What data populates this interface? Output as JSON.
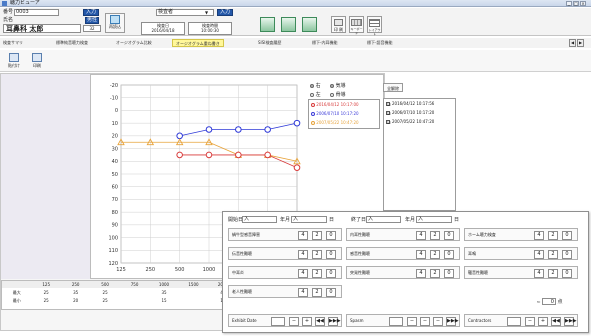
{
  "window": {
    "title": "聴力ビューア"
  },
  "toolbar": {
    "id_label": "番号",
    "id_value": "0003",
    "input_btn_1": "入力",
    "exam_select_value": "検査者",
    "input_btn_2": "入力",
    "name_kana_label": "氏名",
    "sex_btn": "男性",
    "patient_name": "耳鼻科 太郎",
    "age": "32",
    "reload_btn": "再読込",
    "exam_date_label": "検査日",
    "exam_date_value": "2016/04/18",
    "exam_time_label": "検査時間",
    "exam_time_value": "10:00:30",
    "print_btn": "印 刷",
    "keyboard_btn": "キーボード",
    "layout_btn": "レイアウト"
  },
  "tabs": [
    {
      "label": "検査サマリ"
    },
    {
      "label": "標準純音聴力検査"
    },
    {
      "label": "オージオグラム比較"
    },
    {
      "label": "オージオグラム重ね書き"
    },
    {
      "label": "SISI検査履歴"
    },
    {
      "label": "標下-内耳機能"
    },
    {
      "label": "標下-語音機能"
    }
  ],
  "tab_nav": {
    "prev": "◀",
    "next": "▶"
  },
  "subtoolbar": {
    "btn1": "貼付け",
    "btn2": "印刷"
  },
  "right_panel": {
    "ear_right": "右",
    "ear_left": "左",
    "conduction_air": "気導",
    "conduction_bone": "骨導",
    "select_all": "全解除",
    "history_list_a": [
      {
        "text": "2016/04/12 10:17:00",
        "color": "#d83a3a"
      },
      {
        "text": "2006/07/10 10:17:20",
        "color": "#3a3ad8"
      },
      {
        "text": "2007/05/22 10:47:20",
        "color": "#e6a23a"
      }
    ],
    "history_list_b": [
      {
        "text": "2016/04/12 10:17:56",
        "check": "☑"
      },
      {
        "text": "2006/07/10 10:17:20",
        "check": "☑"
      },
      {
        "text": "2007/05/22 10:47:20",
        "check": "☑"
      }
    ]
  },
  "freq_table": {
    "header": [
      "125",
      "250",
      "500",
      "750",
      "1000",
      "1500",
      "2000",
      "3000",
      "4000",
      "6000",
      "8000",
      "平均"
    ],
    "rows": [
      {
        "label": "最大",
        "values": [
          "25",
          "35",
          "25",
          "",
          "35",
          "",
          "40",
          "",
          "35",
          "",
          "50",
          "35"
        ]
      },
      {
        "label": "最小",
        "values": [
          "25",
          "20",
          "25",
          "",
          "15",
          "",
          "15",
          "",
          "15",
          "",
          "20",
          "16"
        ]
      }
    ]
  },
  "popup": {
    "start_date_label": "開始日",
    "start_date_btn": "入",
    "month_label": "年月",
    "month_btn": "入",
    "day_label": "日",
    "end_date_label": "終了日",
    "end_date_btn": "入",
    "end_month_label": "年月",
    "end_month_btn": "入",
    "end_day_label": "日",
    "grid": [
      [
        {
          "label": "蝸牛型感音障害",
          "v1": "4",
          "v2": "2",
          "v3": "0"
        },
        {
          "label": "内耳性難聴",
          "v1": "4",
          "v2": "2",
          "v3": "0"
        },
        {
          "label": "ホーム聴力検査",
          "v1": "4",
          "v2": "2",
          "v3": "0"
        }
      ],
      [
        {
          "label": "伝音性難聴",
          "v1": "4",
          "v2": "2",
          "v3": "0"
        },
        {
          "label": "感音性難聴",
          "v1": "4",
          "v2": "2",
          "v3": "0"
        },
        {
          "label": "耳鳴",
          "v1": "4",
          "v2": "2",
          "v3": "0"
        }
      ],
      [
        {
          "label": "中耳炎",
          "v1": "4",
          "v2": "2",
          "v3": "0"
        },
        {
          "label": "突発性難聴",
          "v1": "4",
          "v2": "2",
          "v3": "0"
        },
        {
          "label": "騒音性難聴",
          "v1": "4",
          "v2": "2",
          "v3": "0"
        }
      ],
      [
        {
          "label": "老人性難聴",
          "v1": "4",
          "v2": "2",
          "v3": "0"
        }
      ]
    ],
    "counter_value": "0",
    "counter_unit": "点",
    "controls": [
      {
        "label": "Exhibit Date",
        "b1": "−",
        "b2": "+",
        "b3": "◀◀",
        "b4": "▶▶▶"
      },
      {
        "label": "Spasm",
        "b1": "−",
        "b2": "−",
        "b3": "−",
        "b4": "▶▶▶"
      },
      {
        "label": "Contractors",
        "b1": "−",
        "b2": "+",
        "b3": "◀◀",
        "b4": "▶▶▶"
      }
    ]
  },
  "chart_data": {
    "type": "line",
    "x_ticks": [
      "125",
      "250",
      "500",
      "1000",
      "2000",
      "4000",
      "8000"
    ],
    "y_ticks": [
      "-20",
      "-10",
      "0",
      "10",
      "20",
      "30",
      "40",
      "50",
      "60",
      "70",
      "80",
      "90",
      "100",
      "110",
      "120"
    ],
    "ylim": [
      -20,
      120
    ],
    "y_inverted": true,
    "grid": true,
    "series": [
      {
        "color": "#2f3ad8",
        "marker": "circle",
        "points": [
          [
            500,
            20
          ],
          [
            1000,
            15
          ],
          [
            2000,
            15
          ],
          [
            4000,
            15
          ],
          [
            8000,
            10
          ]
        ]
      },
      {
        "color": "#e8a33a",
        "marker": "triangle",
        "points": [
          [
            125,
            25
          ],
          [
            250,
            25
          ],
          [
            500,
            25
          ],
          [
            1000,
            25
          ],
          [
            2000,
            35
          ],
          [
            4000,
            35
          ],
          [
            8000,
            40
          ]
        ]
      },
      {
        "color": "#d83a3a",
        "marker": "circle",
        "points": [
          [
            500,
            35
          ],
          [
            1000,
            35
          ],
          [
            2000,
            35
          ],
          [
            4000,
            35
          ],
          [
            8000,
            45
          ]
        ]
      }
    ]
  }
}
